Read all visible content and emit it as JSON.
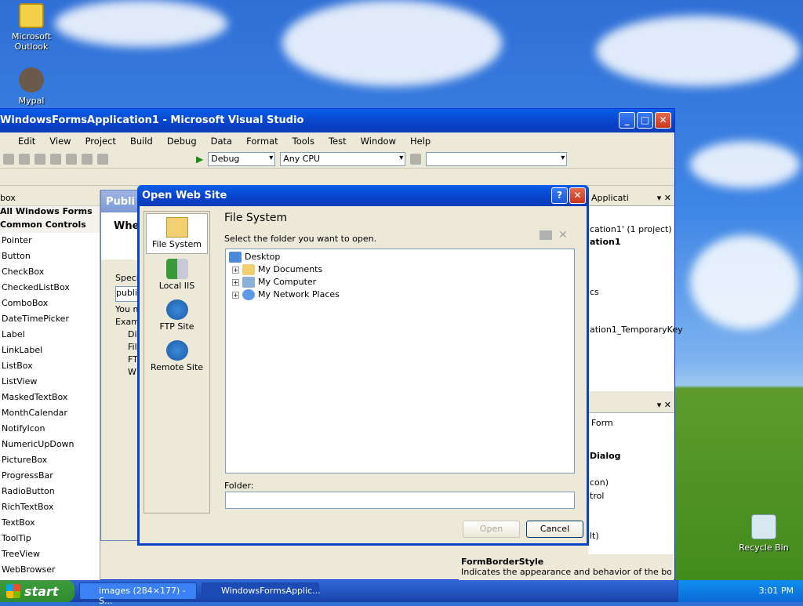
{
  "desktop": {
    "icons": [
      {
        "label": "Microsoft Outlook"
      },
      {
        "label": "Mypal"
      },
      {
        "label": "Recycle Bin"
      }
    ]
  },
  "vs": {
    "title": "WindowsFormsApplication1 - Microsoft Visual Studio",
    "menu": [
      "Edit",
      "View",
      "Project",
      "Build",
      "Debug",
      "Data",
      "Format",
      "Tools",
      "Test",
      "Window",
      "Help"
    ],
    "config": "Debug",
    "platform": "Any CPU"
  },
  "toolbox": {
    "header": "box",
    "category1": "All Windows Forms",
    "category2": "Common Controls",
    "items": [
      "Pointer",
      "Button",
      "CheckBox",
      "CheckedListBox",
      "ComboBox",
      "DateTimePicker",
      "Label",
      "LinkLabel",
      "ListBox",
      "ListView",
      "MaskedTextBox",
      "MonthCalendar",
      "NotifyIcon",
      "NumericUpDown",
      "PictureBox",
      "ProgressBar",
      "RadioButton",
      "RichTextBox",
      "TextBox",
      "ToolTip",
      "TreeView",
      "WebBrowser"
    ]
  },
  "publish": {
    "title": "Publi",
    "heading": "Whe",
    "spec": "Specif",
    "input": "publis",
    "you": "You m",
    "exam": "Exam",
    "l1": "Di",
    "l2": "Fil",
    "l3": "FT",
    "l4": "W"
  },
  "solution": {
    "header": "Applicati",
    "l1": "cation1' (1 project)",
    "l2": "ation1",
    "l3": "cs",
    "l4": "ation1_TemporaryKey"
  },
  "props": {
    "combo": "Form",
    "l1": "Dialog",
    "l2": "con)",
    "l3": "trol",
    "l4": "lt)",
    "desc_title": "FormBorderStyle",
    "desc": "Indicates the appearance and behavior of the border"
  },
  "dialog": {
    "title": "Open Web Site",
    "locations": [
      {
        "label": "File System"
      },
      {
        "label": "Local IIS"
      },
      {
        "label": "FTP Site"
      },
      {
        "label": "Remote Site"
      }
    ],
    "section_title": "File System",
    "instruction": "Select the folder you want to open.",
    "tree_root": "Desktop",
    "tree": [
      {
        "label": "My Documents"
      },
      {
        "label": "My Computer"
      },
      {
        "label": "My Network Places"
      }
    ],
    "folder_label": "Folder:",
    "folder_value": "",
    "open": "Open",
    "cancel": "Cancel",
    "help": "?"
  },
  "taskbar": {
    "start": "start",
    "tasks": [
      {
        "label": "images (284×177) - S..."
      },
      {
        "label": "WindowsFormsApplic..."
      }
    ],
    "clock": "3:01 PM"
  }
}
